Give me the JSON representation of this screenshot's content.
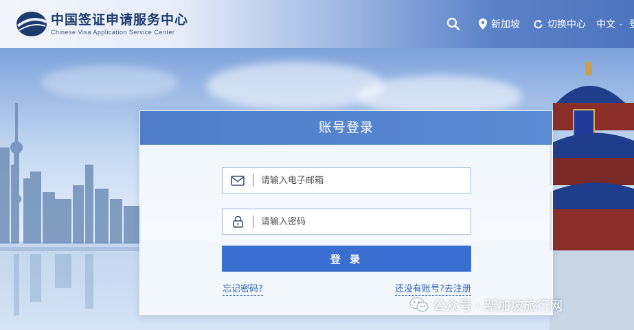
{
  "header": {
    "logo_cn": "中国签证申请服务中心",
    "logo_en": "Chinese Visa Application Service Center",
    "nav": {
      "search_icon": "search-icon",
      "location_label": "新加坡",
      "switch_label": "切换中心",
      "language_label": "中文",
      "extra_label": "登"
    }
  },
  "login": {
    "title": "账号登录",
    "email_placeholder": "请输入电子邮箱",
    "password_placeholder": "请输入密码",
    "submit_label": "登 录",
    "forgot_link": "忘记密码?",
    "register_link": "还没有账号?去注册"
  },
  "watermark": {
    "text": "公众号 · 新加坡旅行网",
    "icon": "wechat-icon"
  },
  "colors": {
    "header_accent": "#4d74bf",
    "card_title_bg": "#4f7dc8",
    "button_bg": "#3a6ed0",
    "link": "#2a5db0"
  }
}
